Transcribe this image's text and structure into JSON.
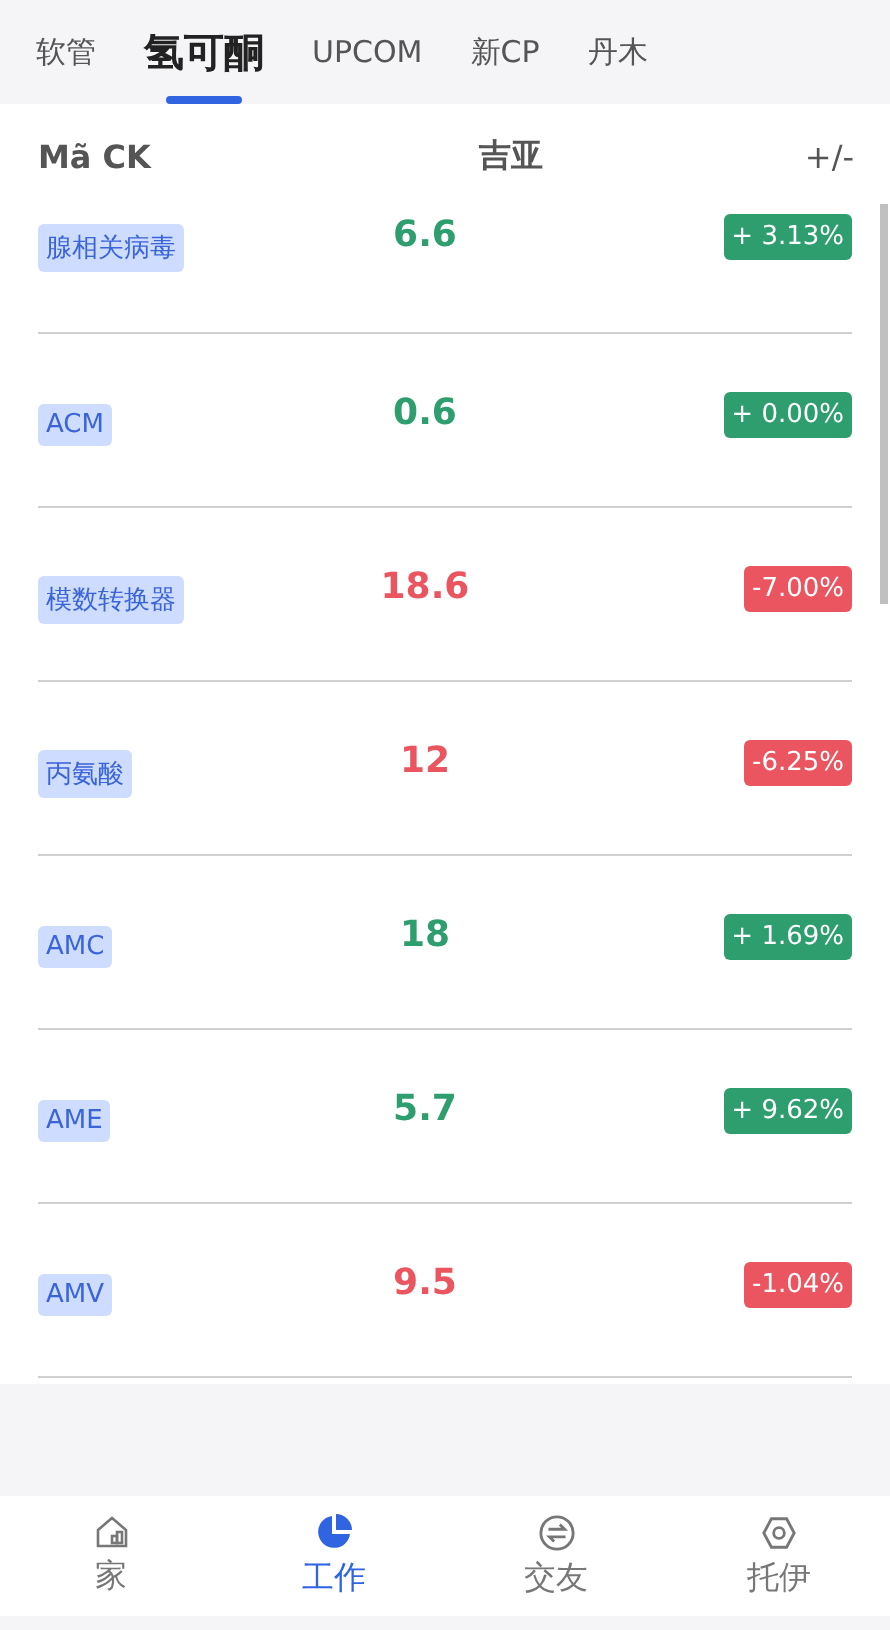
{
  "tabs": [
    {
      "label": "软管",
      "selected": false
    },
    {
      "label": "氢可酮",
      "selected": true
    },
    {
      "label": "UPCOM",
      "selected": false
    },
    {
      "label": "新CP",
      "selected": false
    },
    {
      "label": "丹木",
      "selected": false
    }
  ],
  "table": {
    "columns": [
      "Mã CK",
      "吉亚",
      "+/-"
    ],
    "rows": [
      {
        "symbol": "腺相关病毒",
        "price": "6.6",
        "change": "+ 3.13%",
        "color": "#2e9e6e"
      },
      {
        "symbol": "ACM",
        "price": "0.6",
        "change": "+ 0.00%",
        "color": "#2e9e6e"
      },
      {
        "symbol": "模数转换器",
        "price": "18.6",
        "change": "-7.00%",
        "color": "#ea5560"
      },
      {
        "symbol": "丙氨酸",
        "price": "12",
        "change": "-6.25%",
        "color": "#ea5560"
      },
      {
        "symbol": "AMC",
        "price": "18",
        "change": "+ 1.69%",
        "color": "#2e9e6e"
      },
      {
        "symbol": "AME",
        "price": "5.7",
        "change": "+ 9.62%",
        "color": "#2e9e6e"
      },
      {
        "symbol": "AMV",
        "price": "9.5",
        "change": "-1.04%",
        "color": "#ea5560"
      }
    ]
  },
  "bottom_nav": [
    {
      "label": "家",
      "selected": false
    },
    {
      "label": "工作",
      "selected": true
    },
    {
      "label": "交友",
      "selected": false
    },
    {
      "label": "托伊",
      "selected": false
    }
  ]
}
